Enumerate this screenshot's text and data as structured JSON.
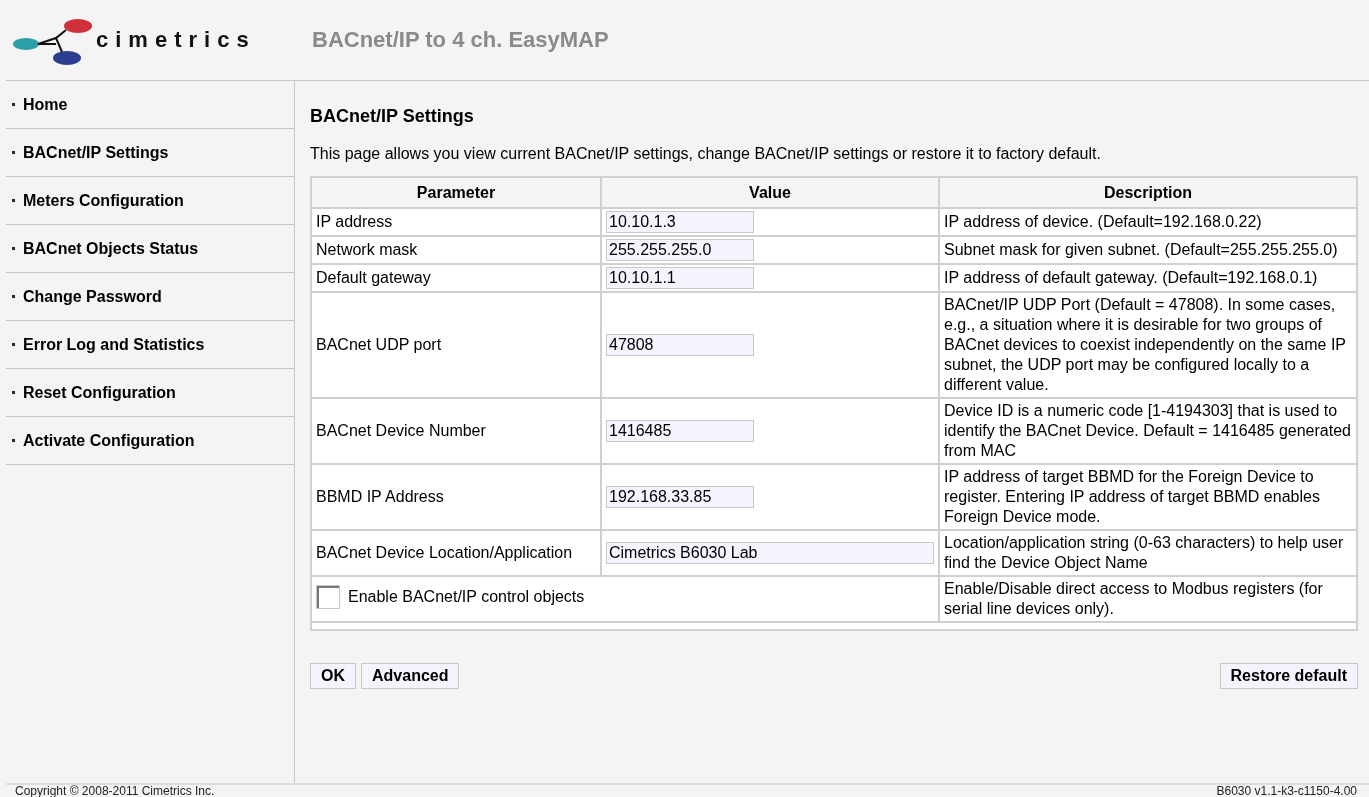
{
  "header": {
    "logo_text": "cimetrics",
    "title": "BACnet/IP to 4 ch. EasyMAP"
  },
  "sidebar": {
    "items": [
      {
        "label": "Home"
      },
      {
        "label": "BACnet/IP Settings"
      },
      {
        "label": "Meters Configuration"
      },
      {
        "label": "BACnet Objects Status"
      },
      {
        "label": "Change Password"
      },
      {
        "label": "Error Log and Statistics"
      },
      {
        "label": "Reset Configuration"
      },
      {
        "label": "Activate Configuration"
      }
    ]
  },
  "page": {
    "heading": "BACnet/IP Settings",
    "intro": "This page allows you view current BACnet/IP settings, change BACnet/IP settings or restore it to factory default."
  },
  "table": {
    "columns": [
      "Parameter",
      "Value",
      "Description"
    ],
    "rows": [
      {
        "kind": "field",
        "parameter": "IP address",
        "value": "10.10.1.3",
        "description": "IP address of device. (Default=192.168.0.22)"
      },
      {
        "kind": "field",
        "parameter": "Network mask",
        "value": "255.255.255.0",
        "description": "Subnet mask for given subnet. (Default=255.255.255.0)"
      },
      {
        "kind": "field",
        "parameter": "Default gateway",
        "value": "10.10.1.1",
        "description": "IP address of default gateway. (Default=192.168.0.1)"
      },
      {
        "kind": "field",
        "parameter": "BACnet UDP port",
        "value": "47808",
        "description": "BACnet/IP UDP Port (Default = 47808). In some cases, e.g., a situation where it is desirable for two groups of BACnet devices to coexist independently on the same IP subnet, the UDP port may be configured locally to a different value."
      },
      {
        "kind": "field",
        "parameter": "BACnet Device Number",
        "value": "1416485",
        "description": "Device ID is a numeric code [1-4194303] that is used to identify the BACnet Device. Default = 1416485 generated from MAC"
      },
      {
        "kind": "field",
        "parameter": "BBMD IP Address",
        "value": "192.168.33.85",
        "description": "IP address of target BBMD for the Foreign Device to register. Entering IP address of target BBMD enables Foreign Device mode."
      },
      {
        "kind": "wide_field",
        "parameter": "BACnet Device Location/Application",
        "value": "Cimetrics B6030 Lab",
        "description": "Location/application string (0-63 characters) to help user find the Device Object Name"
      },
      {
        "kind": "checkbox",
        "parameter": "Enable BACnet/IP control objects",
        "checked": false,
        "description": "Enable/Disable direct access to Modbus registers (for serial line devices only)."
      }
    ]
  },
  "buttons": [
    "OK",
    "Advanced"
  ],
  "restore_button": "Restore default",
  "footer": {
    "copyright": "Copyright © 2008-2011 Cimetrics Inc.",
    "version": "B6030 v1.1-k3-c1150-4.00"
  }
}
